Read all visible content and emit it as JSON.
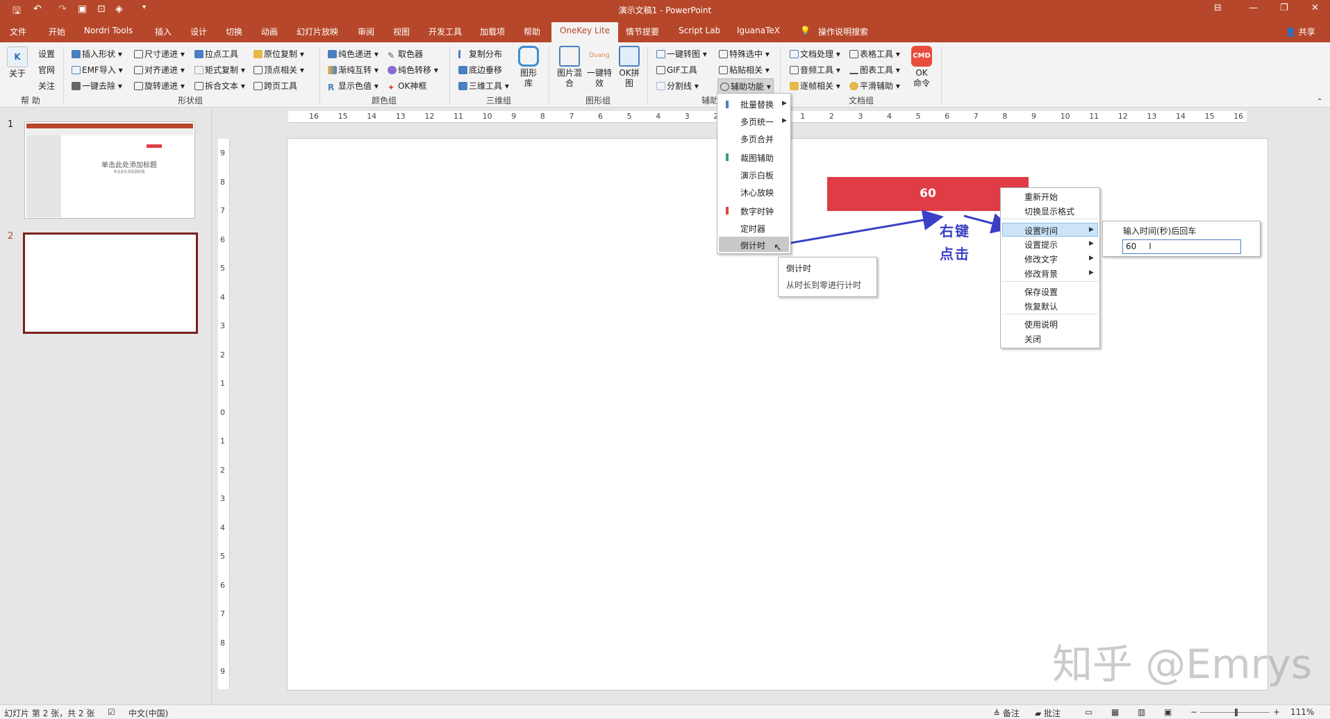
{
  "app": {
    "title": "演示文稿1  -  PowerPoint"
  },
  "titlebar": {
    "undo_label": "↶",
    "redo_label": "↷"
  },
  "tabs": [
    "文件",
    "开始",
    "Nordri Tools",
    "插入",
    "设计",
    "切换",
    "动画",
    "幻灯片放映",
    "审阅",
    "视图",
    "开发工具",
    "加载项",
    "帮助",
    "OneKey Lite",
    "情节提要",
    "Script Lab",
    "IguanaTeX",
    "操作说明搜索"
  ],
  "share_label": "共享",
  "ribbon": {
    "help_group": {
      "about_label": "关于",
      "items": [
        "设置",
        "官网",
        "关注"
      ],
      "group_label": "帮 助"
    },
    "shape_group": {
      "col1": [
        "插入形状",
        "EMF导入",
        "一键去除"
      ],
      "col2": [
        "尺寸递进",
        "对齐递进",
        "旋转递进"
      ],
      "col3": [
        "拉点工具",
        "矩式复制",
        "拆合文本"
      ],
      "col4": [
        "原位复制",
        "顶点相关",
        "跨页工具"
      ],
      "group_label": "形状组"
    },
    "color_group": {
      "col1": [
        "纯色递进",
        "渐纯互转",
        "显示色值"
      ],
      "col2": [
        "取色器",
        "纯色转移",
        "OK神框"
      ],
      "group_label": "颜色组"
    },
    "three_d_group": {
      "items": [
        "复制分布",
        "底边垂移",
        "三维工具"
      ],
      "big_label": "图形库",
      "group_label": "三维组"
    },
    "image_group": {
      "items": [
        "图片混合",
        "一键特效",
        "OK拼图"
      ],
      "group_label": "图形组"
    },
    "aux_group": {
      "col1": [
        "一键转图",
        "GIF工具",
        "分割线"
      ],
      "col2": [
        "特殊选中",
        "粘贴相关",
        "辅助功能"
      ],
      "group_label": "辅助"
    },
    "doc_group": {
      "col1": [
        "文档处理",
        "音频工具",
        "逐帧相关"
      ],
      "col2": [
        "表格工具",
        "图表工具",
        "平滑辅助"
      ],
      "cmd_label": "OK命令",
      "cmd_icon_text": "CMD",
      "group_label": "文档组"
    }
  },
  "ruler_h": [
    "16",
    "15",
    "14",
    "13",
    "12",
    "11",
    "10",
    "9",
    "8",
    "7",
    "6",
    "5",
    "4",
    "3",
    "2",
    "1",
    "0",
    "1",
    "2",
    "3",
    "4",
    "5",
    "6",
    "7",
    "8",
    "9",
    "10",
    "11",
    "12",
    "13",
    "14",
    "15",
    "16"
  ],
  "ruler_v": [
    "9",
    "8",
    "7",
    "6",
    "5",
    "4",
    "3",
    "2",
    "1",
    "0",
    "1",
    "2",
    "3",
    "4",
    "5",
    "6",
    "7",
    "8",
    "9"
  ],
  "slides": {
    "items": [
      {
        "num": "1",
        "title": "单击此处添加标题",
        "subtitle": "单击此处添加副标题"
      },
      {
        "num": "2"
      }
    ]
  },
  "slide": {
    "timer_value": "60",
    "annotation_line1": "右键",
    "annotation_line2": "点击"
  },
  "aux_menu": {
    "items": [
      "批量替换",
      "多页统一",
      "多页合并",
      "裁图辅助",
      "演示白板",
      "沐心放映",
      "数字时钟",
      "定时器",
      "倒计时"
    ]
  },
  "tooltip": {
    "title": "倒计时",
    "desc": "从时长到零进行计时"
  },
  "context_menu": {
    "items": [
      "重新开始",
      "切换显示格式",
      "设置时间",
      "设置提示",
      "修改文字",
      "修改背景",
      "保存设置",
      "恢复默认",
      "使用说明",
      "关闭"
    ]
  },
  "time_submenu": {
    "label": "输入时间(秒)后回车",
    "input_value": "60"
  },
  "statusbar": {
    "slide_info": "幻灯片 第 2 张，共 2 张",
    "language": "中文(中国)",
    "notes": "备注",
    "comments": "批注",
    "zoom": "111%"
  },
  "watermark": "知乎 @Emrys",
  "colors": {
    "accent": "#b7472a",
    "timer_red": "#e03c45",
    "arrow_blue": "#3a3fc6",
    "slide_border": "#7a1f1f"
  }
}
